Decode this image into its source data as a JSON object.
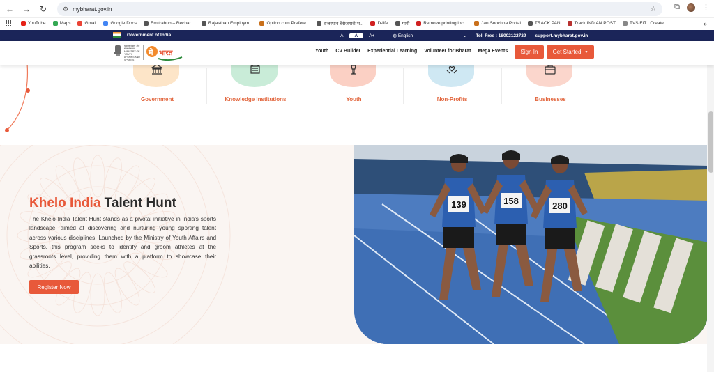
{
  "browser": {
    "url": "mybharat.gov.in",
    "bookmarks": [
      {
        "label": "YouTube",
        "color": "#e62117"
      },
      {
        "label": "Maps",
        "color": "#34a853"
      },
      {
        "label": "Gmail",
        "color": "#ea4335"
      },
      {
        "label": "Google Docs",
        "color": "#4285f4"
      },
      {
        "label": "Emitrahub – Rechar...",
        "color": "#555555"
      },
      {
        "label": "Rajasthan Employm...",
        "color": "#555555"
      },
      {
        "label": "Option cum Prefere...",
        "color": "#c9701b"
      },
      {
        "label": "राजस्थान बेरोजगारी भ...",
        "color": "#555555"
      },
      {
        "label": "D-life",
        "color": "#d02020"
      },
      {
        "label": "गागी",
        "color": "#555555"
      },
      {
        "label": "Remove printing loc...",
        "color": "#d02020"
      },
      {
        "label": "Jan Soochna Portal",
        "color": "#c9701b"
      },
      {
        "label": "TRACK PAN",
        "color": "#555555"
      },
      {
        "label": "Track INDIAN POST",
        "color": "#b8312f"
      },
      {
        "label": "TVS FIT | Create",
        "color": "#888888"
      }
    ]
  },
  "gov_strip": {
    "title": "Government of India",
    "font_sizes": [
      "-A",
      "A",
      "A+"
    ],
    "language": "English",
    "toll_free": "Toll Free : 18002122729",
    "support": "support.mybharat.gov.in"
  },
  "header": {
    "logo_text": "युवा कार्यक्रम और खेल मंत्रालय MINISTRY OF YOUTH AFFAIRS AND SPORTS",
    "logo_brand": "मेरा भारत",
    "menu": [
      "Youth",
      "CV Builder",
      "Experiential Learning",
      "Volunteer for Bharat",
      "Mega Events"
    ],
    "sign_in": "Sign In",
    "get_started": "Get Started"
  },
  "categories": [
    {
      "label": "Government",
      "color": "#fde5c8",
      "icon": "building-icon"
    },
    {
      "label": "Knowledge Institutions",
      "color": "#c9ecd8",
      "icon": "institution-icon"
    },
    {
      "label": "Youth",
      "color": "#fbd0c4",
      "icon": "youth-icon"
    },
    {
      "label": "Non-Profits",
      "color": "#cfe8f3",
      "icon": "hands-heart-icon"
    },
    {
      "label": "Businesses",
      "color": "#fbd6cc",
      "icon": "briefcase-icon"
    }
  ],
  "hero": {
    "title_accent": "Khelo India",
    "title_rest": " Talent Hunt",
    "description": "The Khelo India Talent Hunt stands as a pivotal initiative in India's sports landscape, aimed at discovering and nurturing young sporting talent across various disciplines. Launched by the Ministry of Youth Affairs and Sports, this program seeks to identify and groom athletes at the grassroots level, providing them with a platform to showcase their abilities.",
    "register": "Register Now",
    "bibs": [
      "139",
      "158",
      "280"
    ]
  },
  "colors": {
    "accent": "#e8593a",
    "navy": "#1b2559"
  }
}
